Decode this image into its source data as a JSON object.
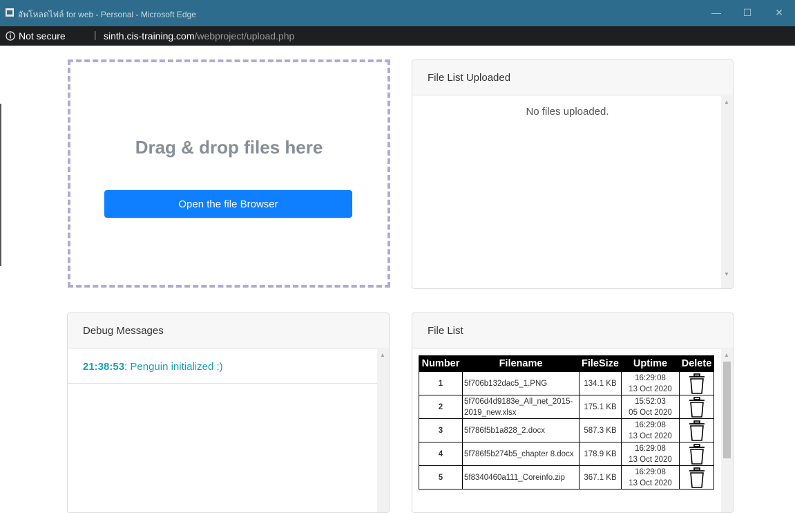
{
  "window": {
    "title": "อัพโหลดไฟล์ for web - Personal - Microsoft Edge",
    "controls": {
      "minimize": "—",
      "maximize": "☐",
      "close": "✕"
    }
  },
  "address": {
    "security_label": "Not secure",
    "separator": "|",
    "host": "sinth.cis-training.com",
    "path": "/webproject/upload.php"
  },
  "dropzone": {
    "title": "Drag & drop files here",
    "button_label": "Open the file Browser",
    "border_color": "#b3a9d6",
    "button_color": "#0d7fff"
  },
  "uploaded_card": {
    "header": "File List Uploaded",
    "empty_text": "No files uploaded."
  },
  "debug_card": {
    "header": "Debug Messages",
    "messages": [
      {
        "time": "21:38:53",
        "text": ": Penguin initialized :)"
      }
    ]
  },
  "filelist_card": {
    "header": "File List",
    "columns": [
      "Number",
      "Filename",
      "FileSize",
      "Uptime",
      "Delete"
    ],
    "rows": [
      {
        "number": "1",
        "filename": "5f706b132dac5_1.PNG",
        "filesize": "134.1 KB",
        "time": "16:29:08",
        "date": "13 Oct 2020"
      },
      {
        "number": "2",
        "filename": "5f706d4d9183e_All_net_2015-2019_new.xlsx",
        "filesize": "175.1 KB",
        "time": "15:52:03",
        "date": "05 Oct 2020"
      },
      {
        "number": "3",
        "filename": "5f786f5b1a828_2.docx",
        "filesize": "587.3 KB",
        "time": "16:29:08",
        "date": "13 Oct 2020"
      },
      {
        "number": "4",
        "filename": "5f786f5b274b5_chapter 8.docx",
        "filesize": "178.9 KB",
        "time": "16:29:08",
        "date": "13 Oct 2020"
      },
      {
        "number": "5",
        "filename": "5f8340460a111_Coreinfo.zip",
        "filesize": "367.1 KB",
        "time": "16:29:08",
        "date": "13 Oct 2020"
      }
    ]
  },
  "icons": {
    "app": "edge-app-icon",
    "info": "info-icon",
    "delete": "trash-icon"
  }
}
